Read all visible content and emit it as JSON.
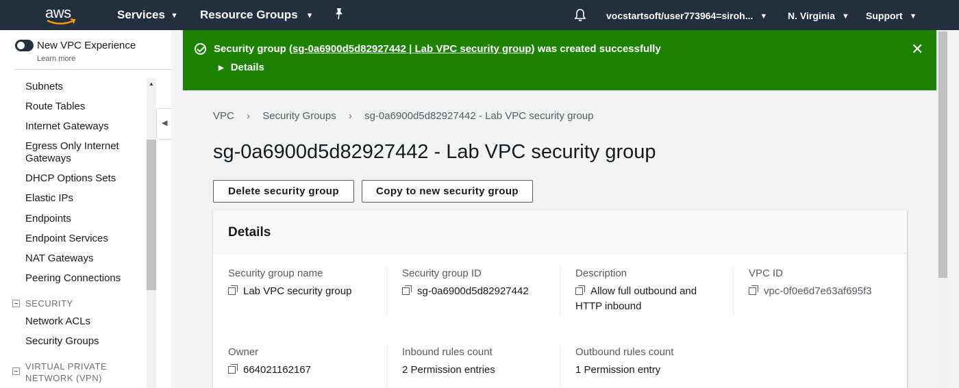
{
  "topnav": {
    "logo": "aws",
    "services": "Services",
    "resource_groups": "Resource Groups",
    "pin_icon": "pin-icon",
    "bell_icon": "bell-icon",
    "account": "vocstartsoft/user773964=siroh...",
    "region": "N. Virginia",
    "support": "Support"
  },
  "sidebar": {
    "toggle_label": "New VPC Experience",
    "learn_more": "Learn more",
    "items": [
      "Subnets",
      "Route Tables",
      "Internet Gateways",
      "Egress Only Internet Gateways",
      "DHCP Options Sets",
      "Elastic IPs",
      "Endpoints",
      "Endpoint Services",
      "NAT Gateways",
      "Peering Connections"
    ],
    "security_section": "SECURITY",
    "security_items": [
      "Network ACLs",
      "Security Groups"
    ],
    "vpn_section": "VIRTUAL PRIVATE NETWORK (VPN)"
  },
  "flash": {
    "prefix": "Security group (",
    "link": "sg-0a6900d5d82927442 | Lab VPC security group",
    "suffix": ") was created successfully",
    "details": "Details",
    "color": "#1d8102"
  },
  "breadcrumb": {
    "vpc": "VPC",
    "security_groups": "Security Groups",
    "current": "sg-0a6900d5d82927442 - Lab VPC security group"
  },
  "page": {
    "title": "sg-0a6900d5d82927442 - Lab VPC security group",
    "delete_button": "Delete security group",
    "copy_button": "Copy to new security group"
  },
  "details": {
    "title": "Details",
    "fields": {
      "sg_name_label": "Security group name",
      "sg_name_value": "Lab VPC security group",
      "sg_id_label": "Security group ID",
      "sg_id_value": "sg-0a6900d5d82927442",
      "description_label": "Description",
      "description_value": "Allow full outbound and HTTP inbound",
      "vpc_id_label": "VPC ID",
      "vpc_id_value": "vpc-0f0e6d7e63af695f3",
      "owner_label": "Owner",
      "owner_value": "664021162167",
      "inbound_label": "Inbound rules count",
      "inbound_value": "2 Permission entries",
      "outbound_label": "Outbound rules count",
      "outbound_value": "1 Permission entry"
    }
  }
}
